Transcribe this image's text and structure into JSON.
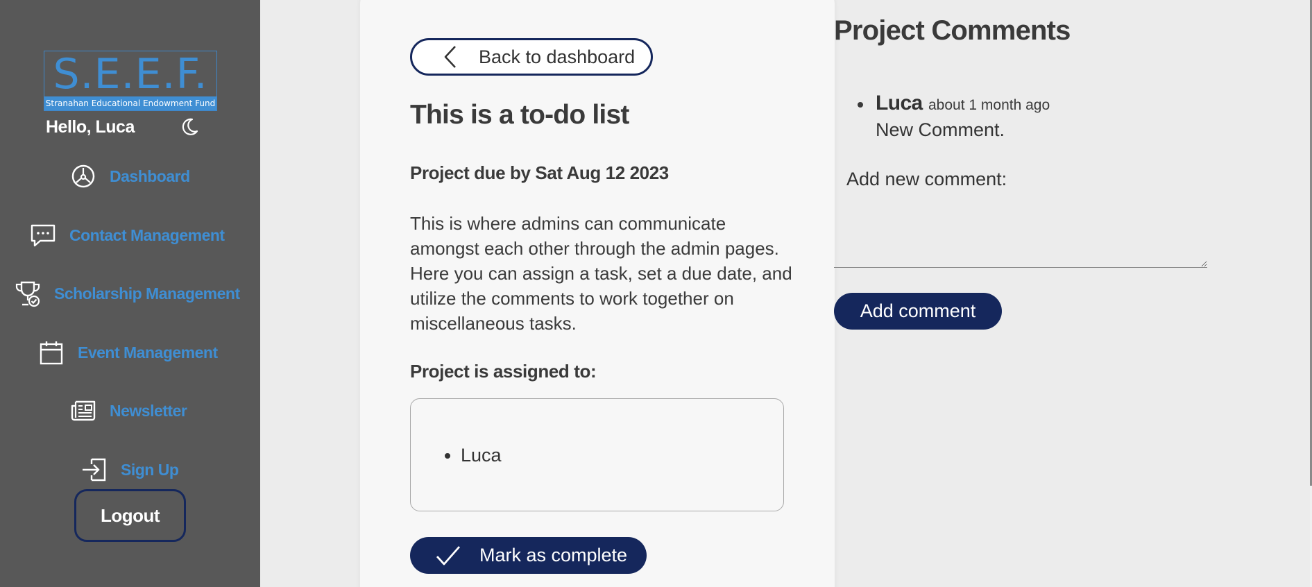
{
  "sidebar": {
    "logo": {
      "main": "S.E.E.F.",
      "subtitle": "Stranahan Educational Endowment Fund"
    },
    "greeting": "Hello, Luca",
    "theme_toggle_icon": "moon-icon",
    "nav": [
      {
        "label": "Dashboard",
        "icon": "dashboard-gauge-icon"
      },
      {
        "label": "Contact Management",
        "icon": "chat-bubble-icon"
      },
      {
        "label": "Scholarship Management",
        "icon": "trophy-icon"
      },
      {
        "label": "Event Management",
        "icon": "calendar-icon"
      },
      {
        "label": "Newsletter",
        "icon": "newspaper-icon"
      },
      {
        "label": "Sign Up",
        "icon": "sign-in-icon"
      }
    ],
    "logout_label": "Logout",
    "colors": {
      "background": "#585858",
      "link": "#3f8ed3"
    }
  },
  "task": {
    "back_label": "Back to dashboard",
    "title": "This is a to-do list",
    "due": "Project due by Sat Aug 12 2023",
    "description": "This is where admins can communicate amongst each other through the admin pages. Here you can assign a task, set a due date, and utilize the comments to work together on miscellaneous tasks.",
    "assigned_label": "Project is assigned to:",
    "assignees": [
      "Luca"
    ],
    "complete_label": "Mark as complete"
  },
  "comments": {
    "title": "Project Comments",
    "items": [
      {
        "author": "Luca",
        "time": "about 1 month ago",
        "text": "New Comment."
      }
    ],
    "add_label": "Add new comment:",
    "input_value": "",
    "button_label": "Add comment"
  },
  "theme": {
    "primary": "#15275c",
    "page_bg": "#ececec",
    "card_bg": "#f7f7f7"
  }
}
